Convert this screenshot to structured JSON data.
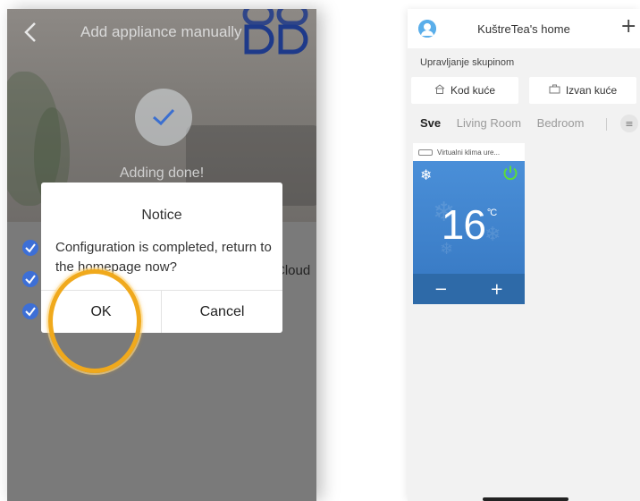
{
  "left": {
    "header": {
      "title": "Add appliance manually"
    },
    "status": {
      "text": "Adding done!"
    },
    "steps": {
      "third_suffix": "Cloud"
    },
    "dialog": {
      "title": "Notice",
      "message": "Configuration is completed, return to the homepage now?",
      "ok_label": "OK",
      "cancel_label": "Cancel"
    },
    "colors": {
      "highlight": "#f0a91c",
      "step_check": "#3d6fd6"
    }
  },
  "right": {
    "header": {
      "title": "KuštreTea's home"
    },
    "group_label": "Upravljanje skupinom",
    "buttons": {
      "home": "Kod kuće",
      "away": "Izvan kuće"
    },
    "tabs": [
      {
        "label": "Sve",
        "active": true
      },
      {
        "label": "Living Room",
        "active": false
      },
      {
        "label": "Bedroom",
        "active": false
      }
    ],
    "device": {
      "name": "Virtualni klima ure...",
      "temperature": "16",
      "unit": "°C",
      "minus": "−",
      "plus": "+"
    },
    "colors": {
      "card": "#4a8fd8",
      "card_controls": "#2e6aa8"
    }
  }
}
